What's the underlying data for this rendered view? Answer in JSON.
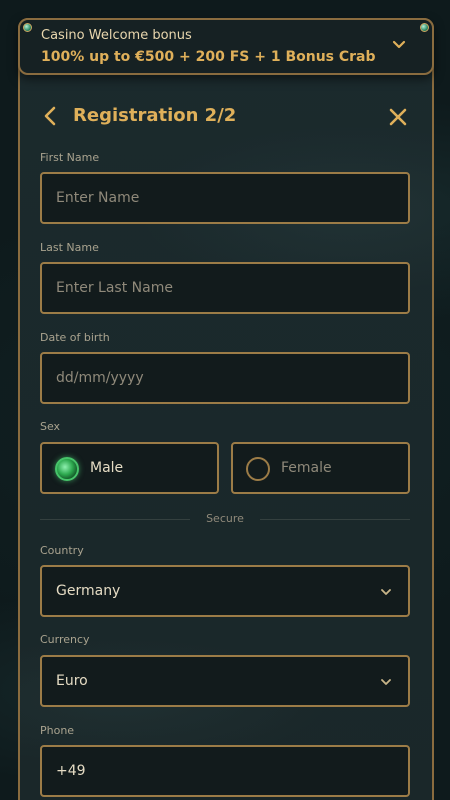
{
  "bonus": {
    "title": "Casino Welcome bonus",
    "offer": "100% up to €500 + 200 FS + 1 Bonus Crab"
  },
  "header": {
    "title": "Registration 2/2"
  },
  "form": {
    "first_name": {
      "label": "First Name",
      "placeholder": "Enter Name"
    },
    "last_name": {
      "label": "Last Name",
      "placeholder": "Enter Last Name"
    },
    "dob": {
      "label": "Date of birth",
      "placeholder": "dd/mm/yyyy"
    },
    "sex": {
      "label": "Sex",
      "options": [
        {
          "label": "Male",
          "selected": true
        },
        {
          "label": "Female",
          "selected": false
        }
      ]
    },
    "divider_text": "Secure",
    "country": {
      "label": "Country",
      "value": "Germany"
    },
    "currency": {
      "label": "Currency",
      "value": "Euro"
    },
    "phone": {
      "label": "Phone",
      "value": "+49"
    }
  },
  "colors": {
    "gold": "#dfb05a",
    "border": "#9c7c47",
    "panel": "#1b2a2d",
    "field_bg": "#121b1c",
    "radio_on": "#2ca84e"
  },
  "icons": {
    "bonus_toggle": "chevron-down-icon",
    "back": "chevron-left-icon",
    "close": "close-icon",
    "select": "chevron-down-icon"
  }
}
